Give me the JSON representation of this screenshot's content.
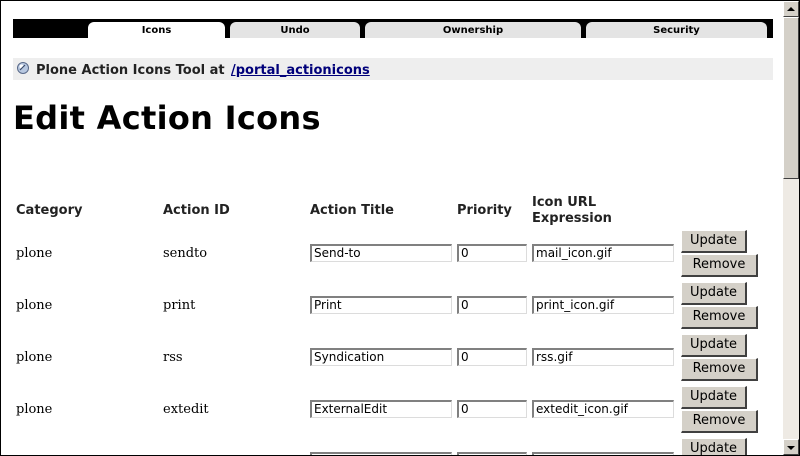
{
  "tabs": [
    {
      "label": "Icons",
      "active": true
    },
    {
      "label": "Undo",
      "active": false
    },
    {
      "label": "Ownership",
      "active": false
    },
    {
      "label": "Security",
      "active": false
    }
  ],
  "location": {
    "icon": "zope-object-icon",
    "label": "Plone Action Icons Tool at",
    "link": "/portal_actionicons"
  },
  "page_title": "Edit Action Icons",
  "table": {
    "headers": {
      "category": "Category",
      "action_id": "Action ID",
      "action_title": "Action Title",
      "priority": "Priority",
      "icon_url_line1": "Icon URL",
      "icon_url_line2": "Expression"
    },
    "rows": [
      {
        "category": "plone",
        "action_id": "sendto",
        "title": "Send-to",
        "priority": "0",
        "icon": "mail_icon.gif"
      },
      {
        "category": "plone",
        "action_id": "print",
        "title": "Print",
        "priority": "0",
        "icon": "print_icon.gif"
      },
      {
        "category": "plone",
        "action_id": "rss",
        "title": "Syndication",
        "priority": "0",
        "icon": "rss.gif"
      },
      {
        "category": "plone",
        "action_id": "extedit",
        "title": "ExternalEdit",
        "priority": "0",
        "icon": "extedit_icon.gif"
      },
      {
        "category": "",
        "action_id": "",
        "title": "",
        "priority": "",
        "icon": ""
      }
    ],
    "update_label": "Update",
    "remove_label": "Remove"
  },
  "colors": {
    "tab_strip": "#000000",
    "tab_active": "#ffffff",
    "tab_inactive": "#e4e4e4",
    "location_bar": "#eeeeee",
    "link": "#00007a",
    "button_face": "#d4d0c8"
  }
}
